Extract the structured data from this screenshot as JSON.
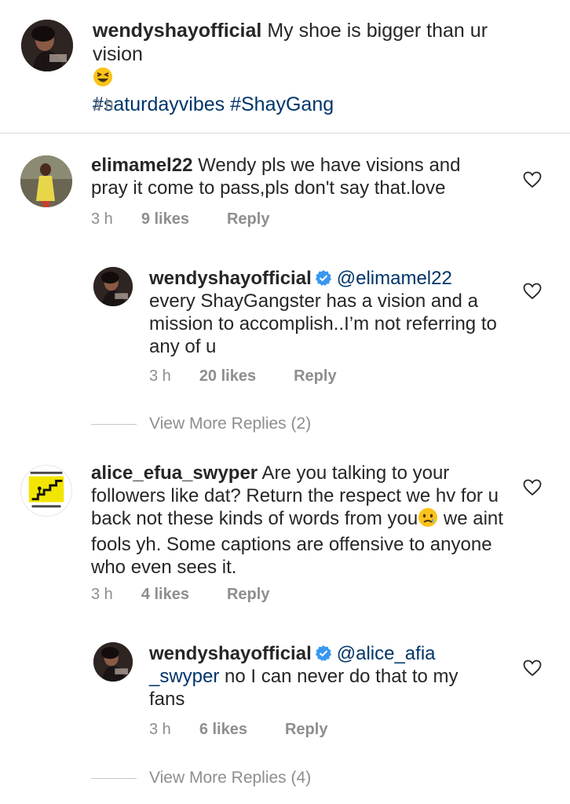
{
  "caption": {
    "username": "wendyshayofficial",
    "text": "My shoe is bigger than ur vision",
    "emoji": "laughing-squint-emoji",
    "hashtags": "#saturdayvibes #ShayGang",
    "time": "3 h"
  },
  "comments": [
    {
      "username": "elimamel22",
      "text": "Wendy pls we have visions and pray it come to pass,pls don't say that.love",
      "time": "3 h",
      "likes": "9 likes",
      "reply": "Reply"
    },
    {
      "username": "wendyshayofficial",
      "mention": "@elimamel22",
      "text": "every ShayGangster has a vision and a mission to accomplish..I’m not referring to any of u",
      "time": "3 h",
      "likes": "20 likes",
      "reply": "Reply"
    },
    {
      "view_more": "View More Replies (2)"
    },
    {
      "username": "alice_efua_swyper",
      "text_before_emoji": "Are you talking to your followers like dat? Return the respect we hv for u back not these kinds of words from you",
      "emoji": "crying-face-emoji",
      "text_after_emoji": " we aint fools yh. Some captions are offensive to anyone who even sees it.",
      "time": "3 h",
      "likes": "4 likes",
      "reply": "Reply"
    },
    {
      "username": "wendyshayofficial",
      "mention": "@alice_afia _swyper",
      "text": "no I can never do that to my fans",
      "time": "3 h",
      "likes": "6 likes",
      "reply": "Reply"
    },
    {
      "view_more": "View More Replies (4)"
    }
  ],
  "colors": {
    "mention": "#003569",
    "meta": "#8e8e8e",
    "verified": "#3897f0"
  }
}
